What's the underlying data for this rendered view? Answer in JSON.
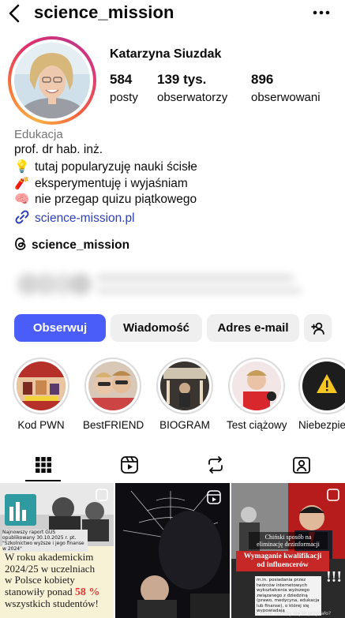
{
  "header": {
    "username": "science_mission",
    "back_icon": "chevron-left-icon",
    "more_icon": "ellipsis-icon"
  },
  "profile": {
    "display_name": "Katarzyna Siuzdak",
    "stats": [
      {
        "value": "584",
        "label": "posty"
      },
      {
        "value": "139 tys.",
        "label": "obserwatorzy"
      },
      {
        "value": "896",
        "label": "obserwowani"
      }
    ],
    "category": "Edukacja",
    "bio": [
      {
        "emoji": "",
        "text": "prof. dr hab. inż."
      },
      {
        "emoji": "💡",
        "text": "tutaj popularyzuję nauki ścisłe"
      },
      {
        "emoji": "🧨",
        "text": "eksperymentuję i wyjaśniam"
      },
      {
        "emoji": "🧠",
        "text": "nie przegap quizu piątkowego"
      }
    ],
    "link": "science-mission.pl",
    "threads_handle": "science_mission"
  },
  "actions": {
    "follow": "Obserwuj",
    "message": "Wiadomość",
    "email": "Adres e-mail",
    "add_user_icon": "add-user-icon"
  },
  "highlights": [
    {
      "label": "Kod PWN"
    },
    {
      "label": "BestFRIEND"
    },
    {
      "label": "BIOGRAM"
    },
    {
      "label": "Test ciążowy"
    },
    {
      "label": "Niebezpie"
    }
  ],
  "tabs": [
    {
      "name": "grid-icon",
      "active": true
    },
    {
      "name": "reels-icon",
      "active": false
    },
    {
      "name": "repost-icon",
      "active": false
    },
    {
      "name": "tagged-icon",
      "active": false
    }
  ],
  "posts": {
    "p1": {
      "caption_small": "Najnowszy raport GUS opublikowany 30.10.2025 r. pt. \"Szkolnictwo wyższe i jego finanse w 2024\"",
      "headline_1": "W roku akademickim",
      "headline_2": "2024/25 w uczelniach",
      "headline_3": "w Polsce kobiety",
      "headline_4": "stanowiły ponad",
      "percent": "58 %",
      "headline_5": "wszystkich studentów!"
    },
    "p3": {
      "top_label": "Chiński sposób na",
      "top_label_2": "eliminację dezinformacji",
      "banner_1": "Wymaganie kwalifikacji",
      "banner_2": "od influencerów",
      "body": "m.in. posiadania przez twórców internetowych wykształcenia wyższego związanego z dziedziną (prawo, medycyna, edukacja lub finanse), o której się wypowiadają",
      "question": "A może nam by się to przydało?",
      "marks": "!!!"
    }
  },
  "colors": {
    "accent": "#4a5df9",
    "link": "#2d3fb5",
    "muted": "#737373",
    "button_bg": "#efefef"
  }
}
